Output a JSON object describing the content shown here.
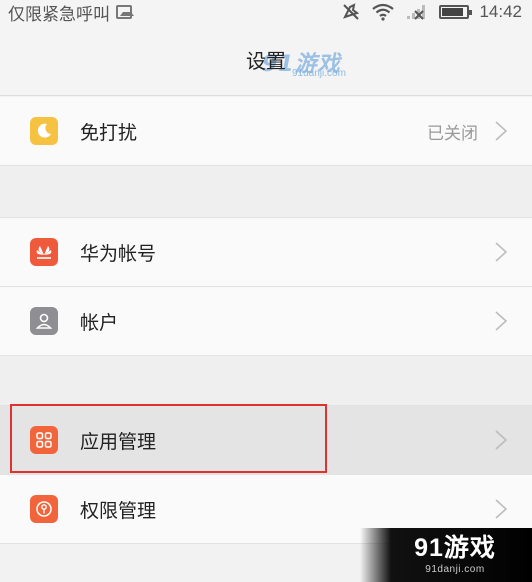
{
  "status_bar": {
    "carrier_text": "仅限紧急呼叫",
    "time": "14:42",
    "icons": [
      "image-notification-icon",
      "mute-icon",
      "wifi-icon",
      "no-signal-icon",
      "battery-icon"
    ]
  },
  "header": {
    "title": "设置",
    "watermark_logo": "91游戏",
    "watermark_url": "91danji.com"
  },
  "settings": {
    "items": [
      {
        "label": "免打扰",
        "value": "已关闭",
        "icon": "moon-icon",
        "color": "#f5c242"
      },
      {
        "label": "华为帐号",
        "icon": "huawei-icon",
        "color": "#ef5a3c"
      },
      {
        "label": "帐户",
        "icon": "account-icon",
        "color": "#8e8e93"
      },
      {
        "label": "应用管理",
        "icon": "apps-grid-icon",
        "color": "#f2643c"
      },
      {
        "label": "权限管理",
        "icon": "permission-icon",
        "color": "#f2643c"
      }
    ]
  },
  "selection": {
    "target": "应用管理",
    "color": "#e0322f"
  },
  "footer_logo": {
    "main": "91游戏",
    "sub": "91danji.com"
  }
}
